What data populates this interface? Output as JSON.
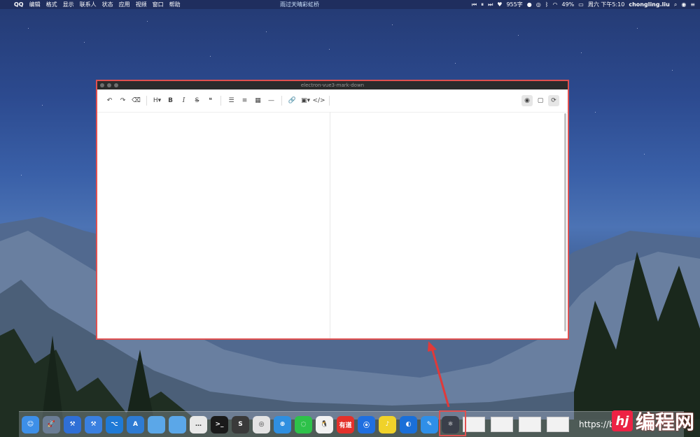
{
  "menubar": {
    "apple": "",
    "app": "QQ",
    "items": [
      "编辑",
      "格式",
      "显示",
      "联系人",
      "状态",
      "应用",
      "视频",
      "窗口",
      "帮助"
    ],
    "now_playing": "雨过天晴彩虹桥",
    "word_count": "955字",
    "battery": "49%",
    "datetime": "周六 下午5:10",
    "user": "chongling.liu"
  },
  "window": {
    "title": "electron-vue3-mark-down"
  },
  "toolbar": {
    "undo": "↶",
    "redo": "↷",
    "clear": "⌫",
    "heading": "H▾",
    "bold": "B",
    "italic": "I",
    "strike": "S",
    "quote": "❝",
    "ul": "☰",
    "ol": "≡",
    "table": "▦",
    "hr": "—",
    "link": "🔗",
    "image": "▣▾",
    "code": "</>",
    "preview": "◉",
    "fullscreen": "▢",
    "sync": "⟳"
  },
  "dock": {
    "apps": [
      {
        "name": "finder",
        "label": "☺",
        "color": "#3d8fe8"
      },
      {
        "name": "launchpad",
        "label": "🚀",
        "color": "#6b7d95"
      },
      {
        "name": "xcode",
        "label": "⚒",
        "color": "#2f6fd6"
      },
      {
        "name": "xcode2",
        "label": "⚒",
        "color": "#3a80e0"
      },
      {
        "name": "vscode",
        "label": "⌥",
        "color": "#1f7ad6"
      },
      {
        "name": "android-studio",
        "label": "A",
        "color": "#2e7bd3"
      },
      {
        "name": "folder1",
        "label": "",
        "color": "#5ba7e8"
      },
      {
        "name": "folder2",
        "label": "",
        "color": "#5ba7e8"
      },
      {
        "name": "messages",
        "label": "…",
        "color": "#e8e8e8"
      },
      {
        "name": "terminal",
        "label": ">_",
        "color": "#1a1a1a"
      },
      {
        "name": "sublime",
        "label": "S",
        "color": "#3a3a3a"
      },
      {
        "name": "chrome",
        "label": "◎",
        "color": "#e3e3e3"
      },
      {
        "name": "safari",
        "label": "⊕",
        "color": "#2f8fe0"
      },
      {
        "name": "wechat",
        "label": "◌",
        "color": "#2ec24a"
      },
      {
        "name": "qq",
        "label": "🐧",
        "color": "#f2f2f2"
      },
      {
        "name": "youdao",
        "label": "有道",
        "color": "#e3312b"
      },
      {
        "name": "maps",
        "label": "⦿",
        "color": "#1f6fe0"
      },
      {
        "name": "qqmusic",
        "label": "♪",
        "color": "#f0d22a"
      },
      {
        "name": "edge",
        "label": "◐",
        "color": "#1a6fd8"
      },
      {
        "name": "notes",
        "label": "✎",
        "color": "#2f8fe8"
      },
      {
        "name": "electron",
        "label": "⚛",
        "color": "#3a3f4a"
      }
    ],
    "trailing_text": "https://b"
  },
  "watermark": {
    "logo": "hj",
    "text": "编程网"
  }
}
